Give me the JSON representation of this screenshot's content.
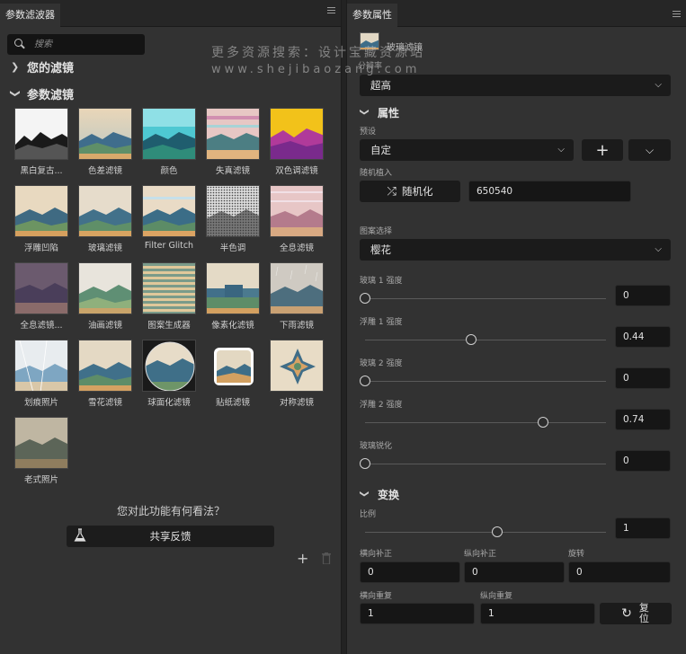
{
  "left_panel": {
    "tab_title": "参数滤波器",
    "search_placeholder": "搜索",
    "your_filters_label": "您的滤镜",
    "param_filters_label": "参数滤镜",
    "filters": [
      {
        "label": "黑白复古..."
      },
      {
        "label": "色差滤镜"
      },
      {
        "label": "颜色"
      },
      {
        "label": "失真滤镜"
      },
      {
        "label": "双色调滤镜"
      },
      {
        "label": "浮雕凹陷"
      },
      {
        "label": "玻璃滤镜"
      },
      {
        "label": "Filter Glitch"
      },
      {
        "label": "半色调"
      },
      {
        "label": "全息滤镜"
      },
      {
        "label": "全息滤镜..."
      },
      {
        "label": "油画滤镜"
      },
      {
        "label": "图案生成器"
      },
      {
        "label": "像素化滤镜"
      },
      {
        "label": "下雨滤镜"
      },
      {
        "label": "划痕照片"
      },
      {
        "label": "雪花滤镜"
      },
      {
        "label": "球面化滤镜"
      },
      {
        "label": "贴纸滤镜"
      },
      {
        "label": "对称滤镜"
      },
      {
        "label": "老式照片"
      }
    ],
    "feedback_question": "您对此功能有何看法？",
    "feedback_button": "共享反馈"
  },
  "right_panel": {
    "tab_title": "参数属性",
    "layer_name": "玻璃滤镜",
    "layer_sub": "分辨率",
    "resolution_value": "超高",
    "properties_label": "属性",
    "preset_label": "预设",
    "preset_value": "自定",
    "random_seed_label": "随机植入",
    "randomize_button": "随机化",
    "seed_value": "650540",
    "pattern_label": "图案选择",
    "pattern_value": "樱花",
    "sliders": [
      {
        "label": "玻璃 1 强度",
        "value": "0",
        "fraction": 0.0
      },
      {
        "label": "浮雕 1 强度",
        "value": "0.44",
        "fraction": 0.44
      },
      {
        "label": "玻璃 2 强度",
        "value": "0",
        "fraction": 0.0
      },
      {
        "label": "浮雕 2 强度",
        "value": "0.74",
        "fraction": 0.74
      },
      {
        "label": "玻璃锐化",
        "value": "0",
        "fraction": 0.0
      }
    ],
    "transform_label": "变换",
    "scale_label": "比例",
    "scale_value": "1",
    "scale_fraction": 0.55,
    "h_offset_label": "横向补正",
    "h_offset_value": "0",
    "v_offset_label": "纵向补正",
    "v_offset_value": "0",
    "rotate_label": "旋转",
    "rotate_value": "0",
    "h_repeat_label": "横向重复",
    "h_repeat_value": "1",
    "v_repeat_label": "纵向重复",
    "v_repeat_value": "1",
    "reset_button": "复位"
  },
  "watermark": {
    "line1": "更多资源搜索：设计宝藏资源站",
    "line2": "www.shejibaozang.com"
  },
  "colors": {
    "panel_bg": "#323232",
    "input_bg": "#1b1b1b",
    "tab_bg": "#262626"
  }
}
